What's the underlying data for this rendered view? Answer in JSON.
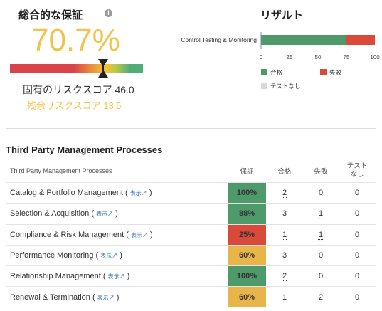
{
  "summary": {
    "assurance_title": "総合的な保証",
    "info_icon_glyph": "i",
    "assurance_value": "70.7%",
    "gauge_level": 0.707,
    "inherent_risk": "固有のリスクスコア 46.0",
    "residual_risk": "残余リスクスコア 13.5"
  },
  "results": {
    "title": "リザルト"
  },
  "chart_data": {
    "type": "bar",
    "orientation": "horizontal",
    "stacked": true,
    "categories": [
      "Control Testing & Monitoring"
    ],
    "series": [
      {
        "name": "合格",
        "values": [
          75
        ],
        "color": "#4e9a6a"
      },
      {
        "name": "失敗",
        "values": [
          25
        ],
        "color": "#d94a3a"
      },
      {
        "name": "テストなし",
        "values": [
          0
        ],
        "color": "#d9d9d9"
      }
    ],
    "xlim": [
      0,
      100
    ],
    "xticks": [
      "0",
      "25",
      "50",
      "75",
      "100"
    ],
    "legend_position": "bottom"
  },
  "section": {
    "title": "Third Party Management Processes"
  },
  "table": {
    "headers": [
      "Third Party Management Processes",
      "保証",
      "合格",
      "失敗",
      "テストなし"
    ],
    "view_label": "表示",
    "view_arrow": "↗",
    "paren_open": "(",
    "paren_close": ")",
    "rows": [
      {
        "name": "Catalog & Portfolio Management",
        "assurance": "100%",
        "color": "#4e9a6a",
        "pass": "2",
        "fail": "0",
        "untested": "0"
      },
      {
        "name": "Selection & Acquisition",
        "assurance": "88%",
        "color": "#4e9a6a",
        "pass": "3",
        "fail": "1",
        "untested": "0"
      },
      {
        "name": "Compliance & Risk Management",
        "assurance": "25%",
        "color": "#d94a3a",
        "pass": "1",
        "fail": "1",
        "untested": "0"
      },
      {
        "name": "Performance Monitoring",
        "assurance": "60%",
        "color": "#e8b54a",
        "pass": "3",
        "fail": "0",
        "untested": "0"
      },
      {
        "name": "Relationship Management",
        "assurance": "100%",
        "color": "#4e9a6a",
        "pass": "2",
        "fail": "0",
        "untested": "0"
      },
      {
        "name": "Renewal & Termination",
        "assurance": "60%",
        "color": "#e8b54a",
        "pass": "1",
        "fail": "2",
        "untested": "0"
      }
    ]
  }
}
